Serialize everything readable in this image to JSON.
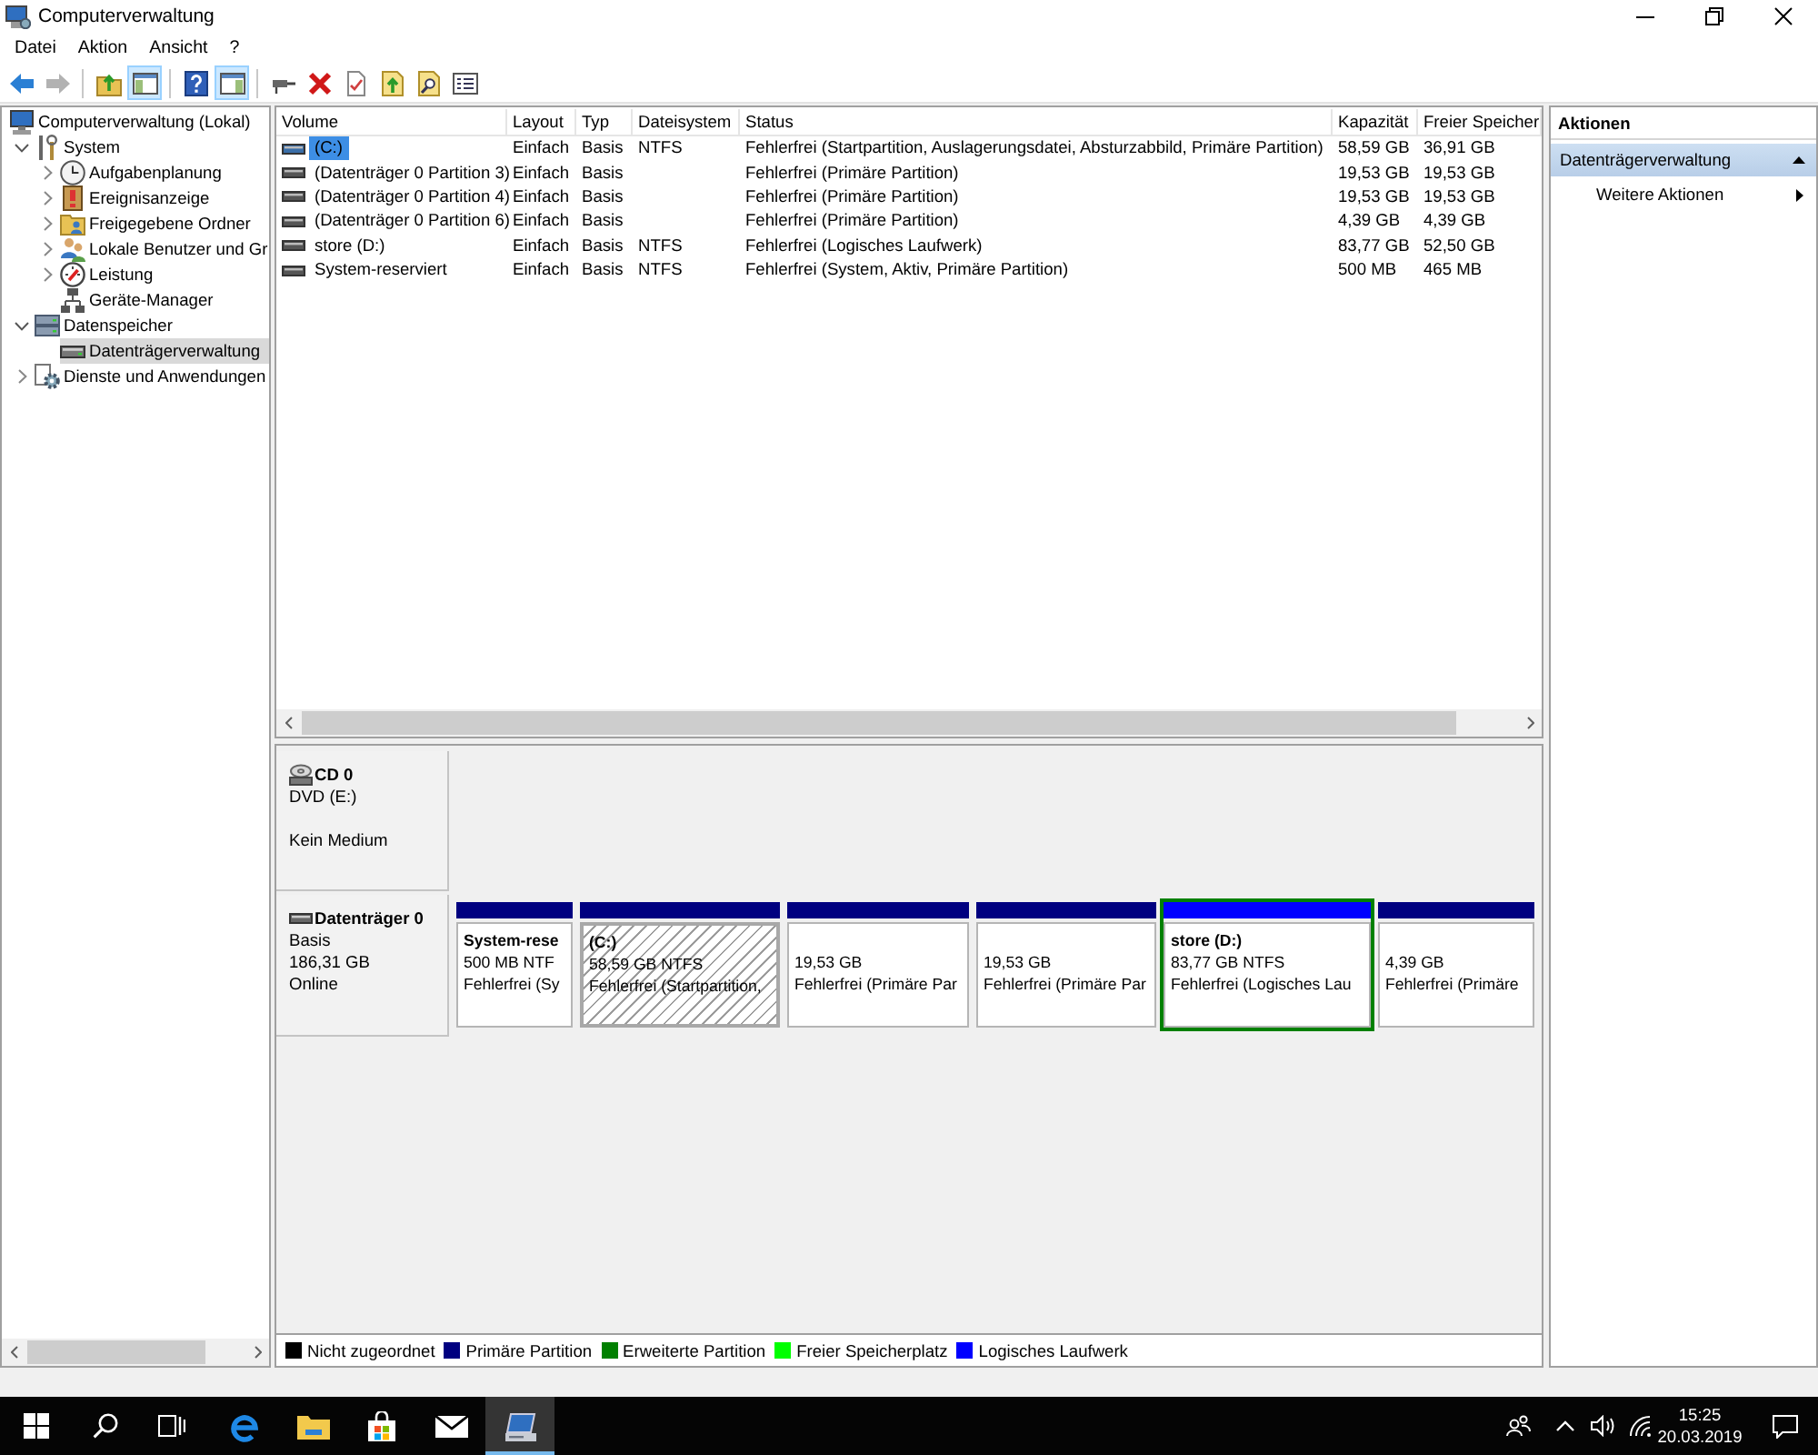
{
  "window": {
    "title": "Computerverwaltung"
  },
  "menu": [
    "Datei",
    "Aktion",
    "Ansicht",
    "?"
  ],
  "toolbar": [
    {
      "buttons": [
        {
          "pressed": false,
          "disabled": false
        },
        {
          "pressed": false,
          "disabled": true
        }
      ]
    },
    {
      "buttons": [
        {
          "pressed": false,
          "disabled": false
        },
        {
          "pressed": true,
          "disabled": false
        }
      ]
    },
    {
      "buttons": [
        {
          "pressed": false,
          "disabled": false
        },
        {
          "pressed": true,
          "disabled": false
        }
      ]
    },
    {
      "buttons": [
        {
          "pressed": false,
          "disabled": false
        },
        {
          "pressed": false,
          "disabled": false
        },
        {
          "pressed": false,
          "disabled": false
        },
        {
          "pressed": false,
          "disabled": false
        },
        {
          "pressed": false,
          "disabled": false
        },
        {
          "pressed": false,
          "disabled": false
        }
      ]
    }
  ],
  "tree": [
    {
      "label": "Computerverwaltung (Lokal)",
      "selected": false,
      "children": [
        {
          "label": "System",
          "expanded": true,
          "selected": false,
          "children": [
            {
              "label": "Aufgabenplanung",
              "expanded": false,
              "selected": false
            },
            {
              "label": "Ereignisanzeige",
              "expanded": false,
              "selected": false
            },
            {
              "label": "Freigegebene Ordner",
              "expanded": false,
              "selected": false
            },
            {
              "label": "Lokale Benutzer und Gr",
              "expanded": false,
              "selected": false
            },
            {
              "label": "Leistung",
              "expanded": false,
              "selected": false
            },
            {
              "label": "Geräte-Manager",
              "selected": false
            }
          ]
        },
        {
          "label": "Datenspeicher",
          "expanded": true,
          "selected": false,
          "children": [
            {
              "label": "Datenträgerverwaltung",
              "selected": true
            }
          ]
        },
        {
          "label": "Dienste und Anwendungen",
          "expanded": false,
          "selected": false
        }
      ]
    }
  ],
  "volume_table": {
    "columns": [
      "Volume",
      "Layout",
      "Typ",
      "Dateisystem",
      "Status",
      "Kapazität",
      "Freier Speicher"
    ],
    "rows": [
      {
        "selected": true,
        "volume": "(C:)",
        "layout": "Einfach",
        "type": "Basis",
        "file_system": "NTFS",
        "status": "Fehlerfrei (Startpartition, Auslagerungsdatei, Absturzabbild, Primäre Partition)",
        "capacity": "58,59 GB",
        "free": "36,91 GB"
      },
      {
        "selected": false,
        "volume": "(Datenträger 0 Partition 3)",
        "layout": "Einfach",
        "type": "Basis",
        "status": "Fehlerfrei (Primäre Partition)",
        "capacity": "19,53 GB",
        "free": "19,53 GB"
      },
      {
        "selected": false,
        "volume": "(Datenträger 0 Partition 4)",
        "layout": "Einfach",
        "type": "Basis",
        "status": "Fehlerfrei (Primäre Partition)",
        "capacity": "19,53 GB",
        "free": "19,53 GB"
      },
      {
        "selected": false,
        "volume": "(Datenträger 0 Partition 6)",
        "layout": "Einfach",
        "type": "Basis",
        "status": "Fehlerfrei (Primäre Partition)",
        "capacity": "4,39 GB",
        "free": "4,39 GB"
      },
      {
        "selected": false,
        "volume": "store (D:)",
        "layout": "Einfach",
        "type": "Basis",
        "file_system": "NTFS",
        "status": "Fehlerfrei (Logisches Laufwerk)",
        "capacity": "83,77 GB",
        "free": "52,50 GB"
      },
      {
        "selected": false,
        "volume": "System-reserviert",
        "layout": "Einfach",
        "type": "Basis",
        "file_system": "NTFS",
        "status": "Fehlerfrei (System, Aktiv, Primäre Partition)",
        "capacity": "500 MB",
        "free": "465 MB"
      }
    ]
  },
  "disks": [
    {
      "kind": "cd",
      "name": "CD 0",
      "type": "DVD (E:)",
      "status": "Kein Medium"
    },
    {
      "kind": "disk",
      "name": "Datenträger 0",
      "type": "Basis",
      "size": "186,31 GB",
      "status": "Online",
      "partitions": [
        {
          "name": "System-rese",
          "size": "500 MB NTF",
          "status": "Fehlerfrei (Sy",
          "color": "#000080",
          "selected": false,
          "extended": false
        },
        {
          "name": "(C:)",
          "size": "58,59 GB NTFS",
          "status": "Fehlerfrei (Startpartition,",
          "color": "#000080",
          "selected": true,
          "extended": false
        },
        {
          "size": "19,53 GB",
          "status": "Fehlerfrei (Primäre Par",
          "color": "#000080",
          "selected": false,
          "extended": false
        },
        {
          "size": "19,53 GB",
          "status": "Fehlerfrei (Primäre Par",
          "color": "#000080",
          "selected": false,
          "extended": false
        },
        {
          "name": "store (D:)",
          "size": "83,77 GB NTFS",
          "status": "Fehlerfrei (Logisches Lau",
          "color": "#0000ff",
          "selected": false,
          "extended": true
        },
        {
          "size": "4,39 GB",
          "status": "Fehlerfrei (Primäre",
          "color": "#000080",
          "selected": false,
          "extended": false
        }
      ]
    }
  ],
  "legend": [
    {
      "color": "#000000",
      "label": "Nicht zugeordnet"
    },
    {
      "color": "#000080",
      "label": "Primäre Partition"
    },
    {
      "color": "#008000",
      "label": "Erweiterte Partition"
    },
    {
      "color": "#00ff00",
      "label": "Freier Speicherplatz"
    },
    {
      "color": "#0000ff",
      "label": "Logisches Laufwerk"
    }
  ],
  "actions": {
    "title": "Aktionen",
    "sections": [
      {
        "label": "Datenträgerverwaltung",
        "expanded": true,
        "items": [
          "Weitere Aktionen"
        ]
      }
    ]
  },
  "taskbar": {
    "apps": [
      {
        "selected": false
      },
      {
        "selected": false
      },
      {
        "selected": false
      },
      {
        "selected": false
      },
      {
        "selected": true
      }
    ],
    "time": "15:25",
    "date": "20.03.2019"
  }
}
